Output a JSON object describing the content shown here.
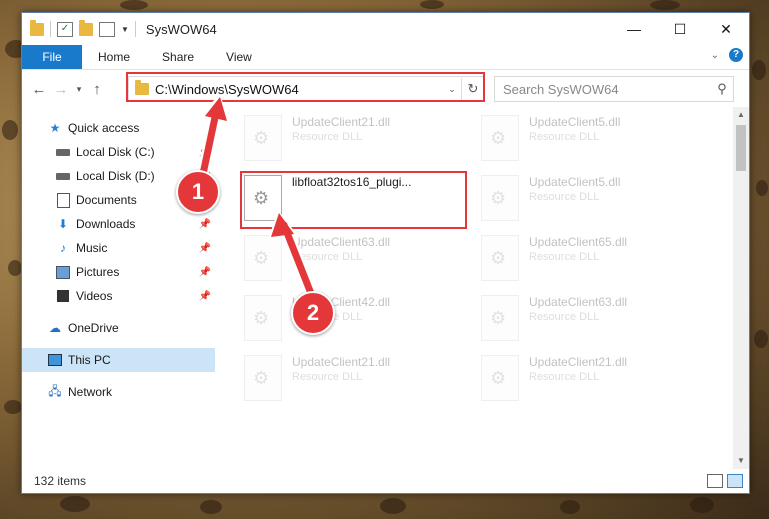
{
  "window": {
    "title": "SysWOW64",
    "controls": {
      "minimize": "—",
      "maximize": "☐",
      "close": "✕"
    }
  },
  "ribbon": {
    "tabs": [
      "File",
      "Home",
      "Share",
      "View"
    ],
    "expand": "⌄",
    "help": "?"
  },
  "nav": {
    "back": "←",
    "forward": "→",
    "recent": "▾",
    "up": "↑",
    "address": "C:\\Windows\\SysWOW64",
    "address_dropdown": "⌄",
    "refresh": "↻",
    "search_placeholder": "Search SysWOW64",
    "search_icon": "⚲"
  },
  "sidebar": {
    "items": [
      {
        "label": "Quick access",
        "icon": "star-icon"
      },
      {
        "label": "Local Disk (C:)",
        "icon": "drive-icon",
        "pinned": true
      },
      {
        "label": "Local Disk (D:)",
        "icon": "drive-icon",
        "pinned": true
      },
      {
        "label": "Documents",
        "icon": "documents-icon",
        "pinned": true
      },
      {
        "label": "Downloads",
        "icon": "downloads-icon",
        "pinned": true
      },
      {
        "label": "Music",
        "icon": "music-icon",
        "pinned": true
      },
      {
        "label": "Pictures",
        "icon": "pictures-icon",
        "pinned": true
      },
      {
        "label": "Videos",
        "icon": "videos-icon",
        "pinned": true
      },
      {
        "label": "OneDrive",
        "icon": "onedrive-icon"
      },
      {
        "label": "This PC",
        "icon": "this-pc-icon",
        "selected": true
      },
      {
        "label": "Network",
        "icon": "network-icon"
      }
    ],
    "pin_glyph": "📌"
  },
  "files": [
    {
      "name": "UpdateClient21.dll",
      "type": "Resource DLL"
    },
    {
      "name": "UpdateClient5.dll",
      "type": "Resource DLL"
    },
    {
      "name": "libfloat32tos16_plugi...",
      "type": ""
    },
    {
      "name": "UpdateClient5.dll",
      "type": "Resource DLL"
    },
    {
      "name": "UpdateClient63.dll",
      "type": "Resource DLL"
    },
    {
      "name": "UpdateClient65.dll",
      "type": "Resource DLL"
    },
    {
      "name": "UpdateClient42.dll",
      "type": "Resource DLL"
    },
    {
      "name": "UpdateClient63.dll",
      "type": "Resource DLL"
    },
    {
      "name": "UpdateClient21.dll",
      "type": "Resource DLL"
    },
    {
      "name": "UpdateClient21.dll",
      "type": "Resource DLL"
    }
  ],
  "status": {
    "count": "132 items"
  },
  "callouts": [
    "1",
    "2"
  ],
  "colors": {
    "accent": "#1979ca",
    "highlight": "#e4373a",
    "selected": "#cce4f7"
  }
}
